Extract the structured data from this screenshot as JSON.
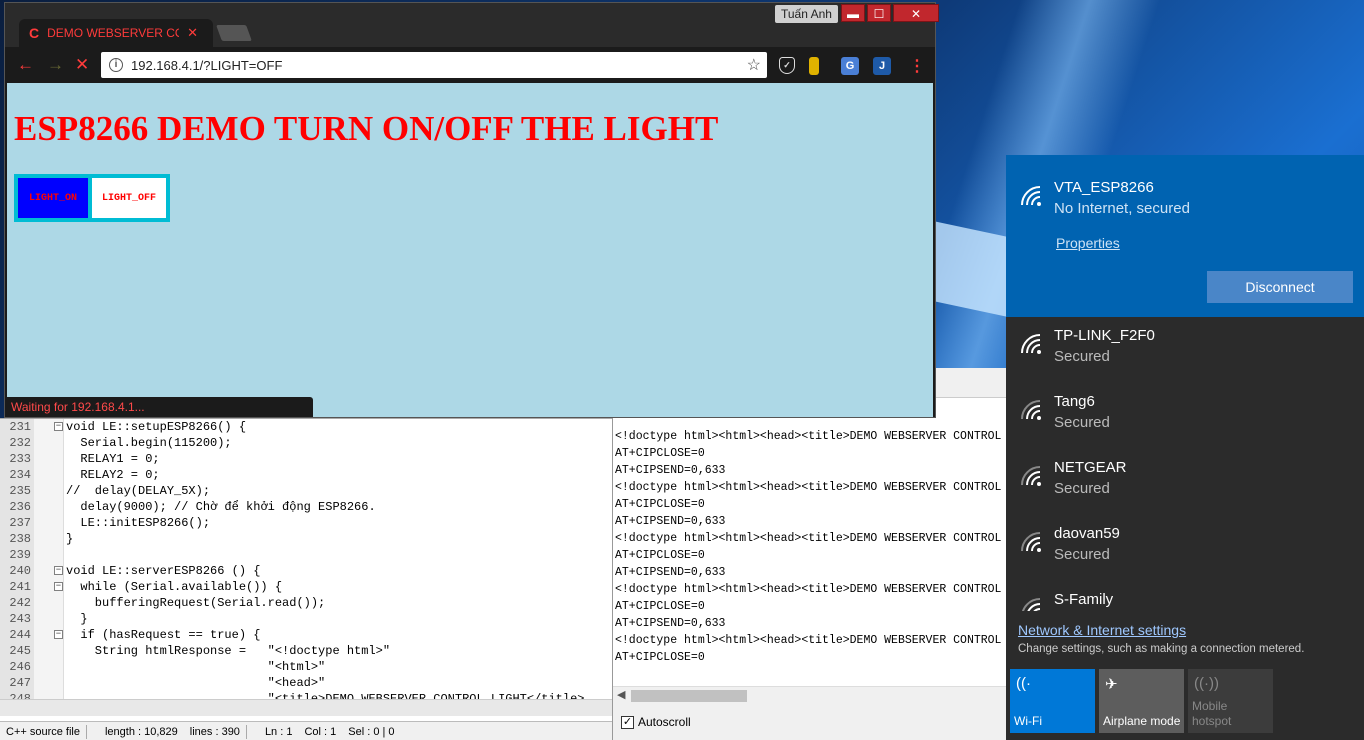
{
  "browser": {
    "tab_title": "DEMO WEBSERVER CON",
    "user_name": "Tuấn Anh",
    "url": "192.168.4.1/?LIGHT=OFF",
    "status_text": "Waiting for 192.168.4.1...",
    "page": {
      "heading": "ESP8266 DEMO TURN ON/OFF THE LIGHT",
      "btn_on": "LIGHT_ON",
      "btn_off": "LIGHT_OFF"
    }
  },
  "editor": {
    "lines": [
      {
        "num": "231",
        "fold": "⊟",
        "text": "void LE::setupESP8266() {"
      },
      {
        "num": "232",
        "fold": "",
        "text": "  Serial.begin(115200);"
      },
      {
        "num": "233",
        "fold": "",
        "text": "  RELAY1 = 0;"
      },
      {
        "num": "234",
        "fold": "",
        "text": "  RELAY2 = 0;"
      },
      {
        "num": "235",
        "fold": "",
        "text": "//  delay(DELAY_5X);"
      },
      {
        "num": "236",
        "fold": "",
        "text": "  delay(9000); // Chờ để khởi động ESP8266."
      },
      {
        "num": "237",
        "fold": "",
        "text": "  LE::initESP8266();"
      },
      {
        "num": "238",
        "fold": "",
        "text": "}"
      },
      {
        "num": "239",
        "fold": "",
        "text": ""
      },
      {
        "num": "240",
        "fold": "⊟",
        "text": "void LE::serverESP8266 () {"
      },
      {
        "num": "241",
        "fold": "⊟",
        "text": "  while (Serial.available()) {"
      },
      {
        "num": "242",
        "fold": "",
        "text": "    bufferingRequest(Serial.read());"
      },
      {
        "num": "243",
        "fold": "",
        "text": "  }"
      },
      {
        "num": "244",
        "fold": "⊟",
        "text": "  if (hasRequest == true) {"
      },
      {
        "num": "245",
        "fold": "",
        "text": "    String htmlResponse =   \"<!doctype html>\""
      },
      {
        "num": "246",
        "fold": "",
        "text": "                            \"<html>\""
      },
      {
        "num": "247",
        "fold": "",
        "text": "                            \"<head>\""
      },
      {
        "num": "248",
        "fold": "",
        "text": "                            \"<title>DEMO WEBSERVER CONTROL LIGHT</title>"
      }
    ],
    "status": {
      "file_type": "C++ source file",
      "length": "length : 10,829",
      "lines": "lines : 390",
      "ln": "Ln : 1",
      "col": "Col : 1",
      "sel": "Sel : 0 | 0"
    }
  },
  "serial": {
    "log": [
      "<!doctype html><html><head><title>DEMO WEBSERVER CONTROL",
      "AT+CIPCLOSE=0",
      "AT+CIPSEND=0,633",
      "<!doctype html><html><head><title>DEMO WEBSERVER CONTROL",
      "AT+CIPCLOSE=0",
      "AT+CIPSEND=0,633",
      "<!doctype html><html><head><title>DEMO WEBSERVER CONTROL",
      "AT+CIPCLOSE=0",
      "AT+CIPSEND=0,633",
      "<!doctype html><html><head><title>DEMO WEBSERVER CONTROL",
      "AT+CIPCLOSE=0",
      "AT+CIPSEND=0,633",
      "<!doctype html><html><head><title>DEMO WEBSERVER CONTROL",
      "AT+CIPCLOSE=0"
    ],
    "autoscroll_label": "Autoscroll",
    "autoscroll_checked": true
  },
  "wifi": {
    "connected": {
      "name": "VTA_ESP8266",
      "status": "No Internet, secured"
    },
    "properties_label": "Properties",
    "disconnect_label": "Disconnect",
    "networks": [
      {
        "name": "TP-LINK_F2F0",
        "status": "Secured"
      },
      {
        "name": "Tang6",
        "status": "Secured"
      },
      {
        "name": "NETGEAR",
        "status": "Secured"
      },
      {
        "name": "daovan59",
        "status": "Secured"
      },
      {
        "name": "S-Family",
        "status": ""
      }
    ],
    "settings_label": "Network & Internet settings",
    "settings_sub": "Change settings, such as making a connection metered.",
    "quick_actions": [
      {
        "label": "Wi-Fi",
        "icon": "wifi-icon",
        "state": "on"
      },
      {
        "label": "Airplane mode",
        "icon": "airplane-icon",
        "state": "off"
      },
      {
        "label": "Mobile hotspot",
        "icon": "hotspot-icon",
        "state": "disabled"
      }
    ]
  },
  "colors": {
    "accent": "#0063b1",
    "chrome_red": "#ff3b3b",
    "page_bg": "#add8e6"
  }
}
